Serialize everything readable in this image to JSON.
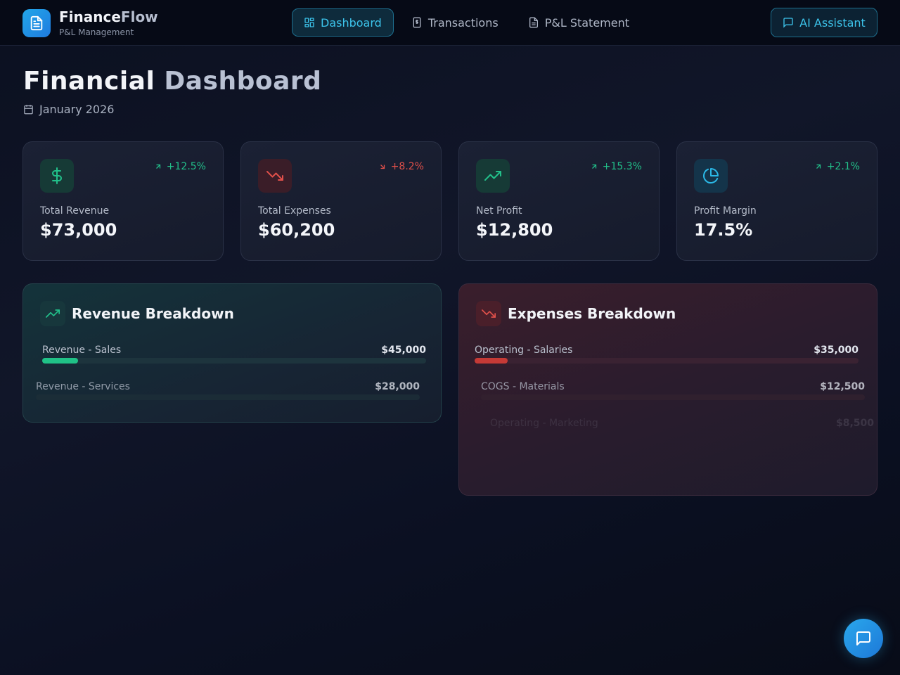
{
  "brand": {
    "name_part1": "Finance",
    "name_part2": "Flow",
    "subtitle": "P&L Management"
  },
  "nav": [
    {
      "label": "Dashboard",
      "icon": "dashboard-icon",
      "active": true
    },
    {
      "label": "Transactions",
      "icon": "receipt-icon",
      "active": false
    },
    {
      "label": "P&L Statement",
      "icon": "document-icon",
      "active": false
    }
  ],
  "ai_button": {
    "label": "AI Assistant",
    "icon": "chat-icon"
  },
  "page": {
    "title_part1": "Financial",
    "title_part2": "Dashboard",
    "period": "January 2026"
  },
  "kpis": [
    {
      "label": "Total Revenue",
      "value": "$73,000",
      "change": "+12.5%",
      "trend": "up",
      "icon": "dollar-icon",
      "color": "#22c08a"
    },
    {
      "label": "Total Expenses",
      "value": "$60,200",
      "change": "+8.2%",
      "trend": "down",
      "icon": "trending-down-icon",
      "color": "#e0504a"
    },
    {
      "label": "Net Profit",
      "value": "$12,800",
      "change": "+15.3%",
      "trend": "up",
      "icon": "trending-up-icon",
      "color": "#22c08a"
    },
    {
      "label": "Profit Margin",
      "value": "17.5%",
      "change": "+2.1%",
      "trend": "up",
      "icon": "pie-chart-icon",
      "color": "#2bb8e6"
    }
  ],
  "revenue_breakdown": {
    "title": "Revenue Breakdown",
    "items": [
      {
        "label": "Revenue - Sales",
        "value": "$45,000",
        "fill_fraction": 0.093
      },
      {
        "label": "Revenue - Services",
        "value": "$28,000",
        "fill_fraction": 0
      }
    ]
  },
  "expenses_breakdown": {
    "title": "Expenses Breakdown",
    "items": [
      {
        "label": "Operating - Salaries",
        "value": "$35,000",
        "fill_fraction": 0.086
      },
      {
        "label": "COGS - Materials",
        "value": "$12,500",
        "fill_fraction": 0
      },
      {
        "label": "Operating - Marketing",
        "value": "$8,500",
        "fill_fraction": 0
      }
    ]
  },
  "colors": {
    "accent": "#2bb8e6",
    "positive": "#22c08a",
    "negative": "#e0504a"
  }
}
